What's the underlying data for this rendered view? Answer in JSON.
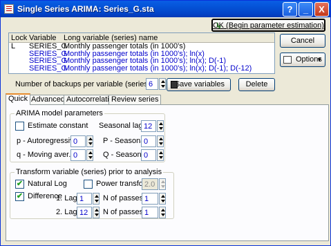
{
  "window": {
    "title": "Single Series ARIMA: Series_G.sta",
    "controls": {
      "help": "?",
      "minimize": "_",
      "close": "X"
    }
  },
  "buttons": {
    "ok": "OK (Begin parameter estimation)",
    "cancel": "Cancel",
    "options": "Options",
    "save_variables": "Save variables",
    "delete": "Delete"
  },
  "variable_list": {
    "columns": [
      "Lock",
      "Variable",
      "Long variable (series) name"
    ],
    "rows": [
      {
        "lock": "L",
        "variable": "SERIES_G",
        "long_name": "Monthly passenger totals (in 1000's)",
        "selected": false
      },
      {
        "lock": "",
        "variable": "SERIES_G",
        "long_name": "Monthly passenger totals (in 1000's); ln(x)",
        "selected": true
      },
      {
        "lock": "",
        "variable": "SERIES_G",
        "long_name": "Monthly passenger totals (in 1000's); ln(x); D(-1)",
        "selected": true
      },
      {
        "lock": "",
        "variable": "SERIES_G",
        "long_name": "Monthly passenger totals (in 1000's); ln(x); D(-1); D(-12)",
        "selected": true
      }
    ]
  },
  "backups": {
    "label": "Number of backups per variable (series):",
    "value": "6"
  },
  "tabs": [
    {
      "label": "Quick",
      "active": true
    },
    {
      "label": "Advanced",
      "active": false
    },
    {
      "label": "Autocorrelations",
      "active": false
    },
    {
      "label": "Review series",
      "active": false
    }
  ],
  "arima": {
    "group_title": "ARIMA model parameters",
    "estimate_constant": {
      "label": "Estimate constant",
      "checked": false
    },
    "seasonal_lag": {
      "label": "Seasonal lag:",
      "value": "12"
    },
    "p": {
      "label": "p - Autoregressive:",
      "value": "0"
    },
    "P": {
      "label": "P - Seasonal:",
      "value": "0"
    },
    "q": {
      "label": "q - Moving aver.:",
      "value": "0"
    },
    "Q": {
      "label": "Q - Seasonal:",
      "value": "0"
    }
  },
  "transform": {
    "group_title": "Transform variable (series) prior to analysis",
    "natural_log": {
      "label": "Natural Log",
      "checked": true
    },
    "power_transform": {
      "label": "Power transform:",
      "checked": false,
      "value": "2.0"
    },
    "difference": {
      "label": "Difference",
      "checked": true
    },
    "lag1": {
      "label": "1. Lag:",
      "value": "1",
      "passes_label": "N of passes:",
      "passes": "1"
    },
    "lag2": {
      "label": "2. Lag:",
      "value": "12",
      "passes_label": "N of passes:",
      "passes": "1"
    }
  }
}
